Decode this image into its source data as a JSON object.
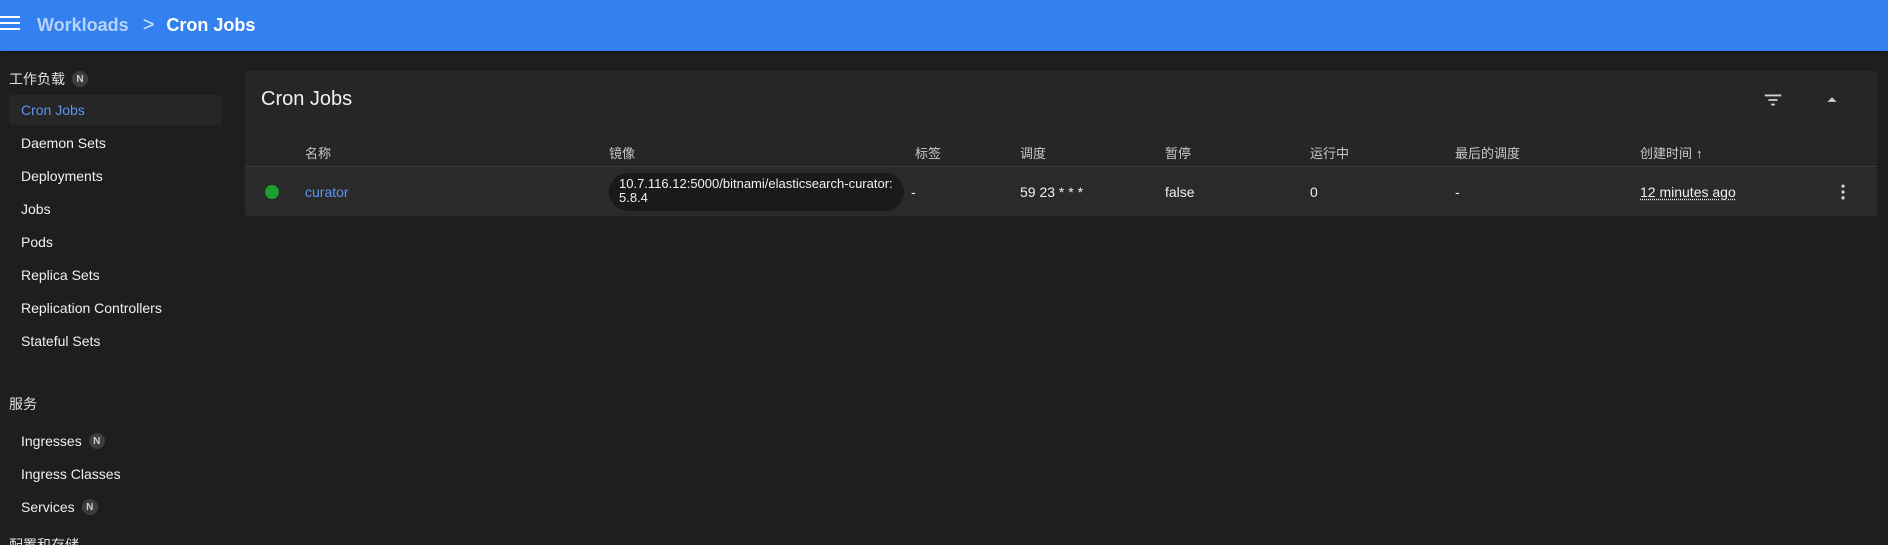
{
  "header": {
    "breadcrumb_parent": "Workloads",
    "breadcrumb_separator": ">",
    "breadcrumb_current": "Cron Jobs"
  },
  "sidebar": {
    "sections": [
      {
        "title": "工作负载",
        "badge": "N"
      },
      {
        "title": "服务"
      },
      {
        "title": "配置和存储"
      }
    ],
    "workload_items": [
      {
        "label": "Cron Jobs",
        "active": true
      },
      {
        "label": "Daemon Sets"
      },
      {
        "label": "Deployments"
      },
      {
        "label": "Jobs"
      },
      {
        "label": "Pods"
      },
      {
        "label": "Replica Sets"
      },
      {
        "label": "Replication Controllers"
      },
      {
        "label": "Stateful Sets"
      }
    ],
    "service_items": [
      {
        "label": "Ingresses",
        "badge": "N"
      },
      {
        "label": "Ingress Classes"
      },
      {
        "label": "Services",
        "badge": "N"
      }
    ]
  },
  "card": {
    "title": "Cron Jobs",
    "columns": {
      "name": "名称",
      "image": "镜像",
      "labels": "标签",
      "schedule": "调度",
      "suspend": "暂停",
      "active": "运行中",
      "last_schedule": "最后的调度",
      "created": "创建时间",
      "sort_indicator": "↑"
    },
    "rows": [
      {
        "name": "curator",
        "image": "10.7.116.12:5000/bitnami/elasticsearch-curator:5.8.4",
        "labels": "-",
        "schedule": "59 23 * * *",
        "suspend": "false",
        "active": "0",
        "last_schedule": "-",
        "created": "12 minutes ago",
        "status_color": "#1e9e2e"
      }
    ]
  },
  "colors": {
    "topbar": "#3381f0",
    "accent": "#5a96f2",
    "background": "#1e1e1e",
    "card": "#262626"
  }
}
